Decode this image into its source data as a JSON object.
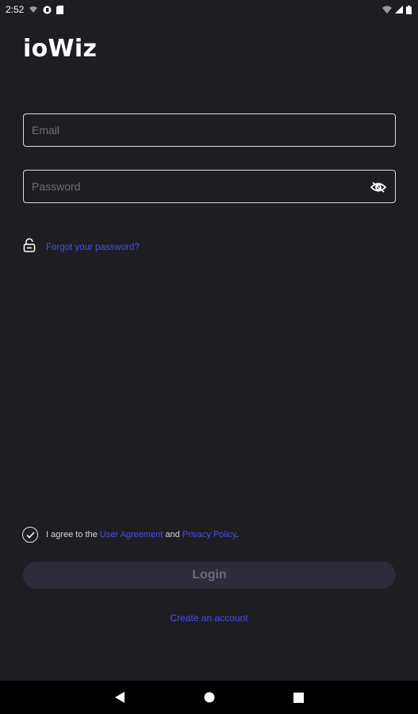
{
  "status_bar": {
    "time": "2:52",
    "icons": [
      "wifi-calling-icon",
      "app-notification-icon",
      "sd-card-icon",
      "wifi-icon",
      "signal-icon",
      "battery-icon"
    ]
  },
  "app": {
    "title": "ioWiz"
  },
  "form": {
    "email_placeholder": "Email",
    "email_value": "",
    "password_placeholder": "Password",
    "password_value": "",
    "password_toggle_icon": "eye-off-icon",
    "forgot_password": "Forgot your password?",
    "forgot_icon": "lock-icon"
  },
  "agreement": {
    "checked": true,
    "prefix": "I agree to the ",
    "user_agreement": "User Agreement",
    "and": " and ",
    "privacy_policy": "Privacy Policy",
    "suffix": "."
  },
  "actions": {
    "login": "Login",
    "create_account": "Create an account"
  },
  "colors": {
    "background": "#1e1d22",
    "link": "#4a4ff0",
    "login_button_bg": "#2c2c3a",
    "login_button_text": "#6b6b78"
  },
  "nav_bar": {
    "buttons": [
      "back-icon",
      "home-icon",
      "recents-icon"
    ]
  }
}
